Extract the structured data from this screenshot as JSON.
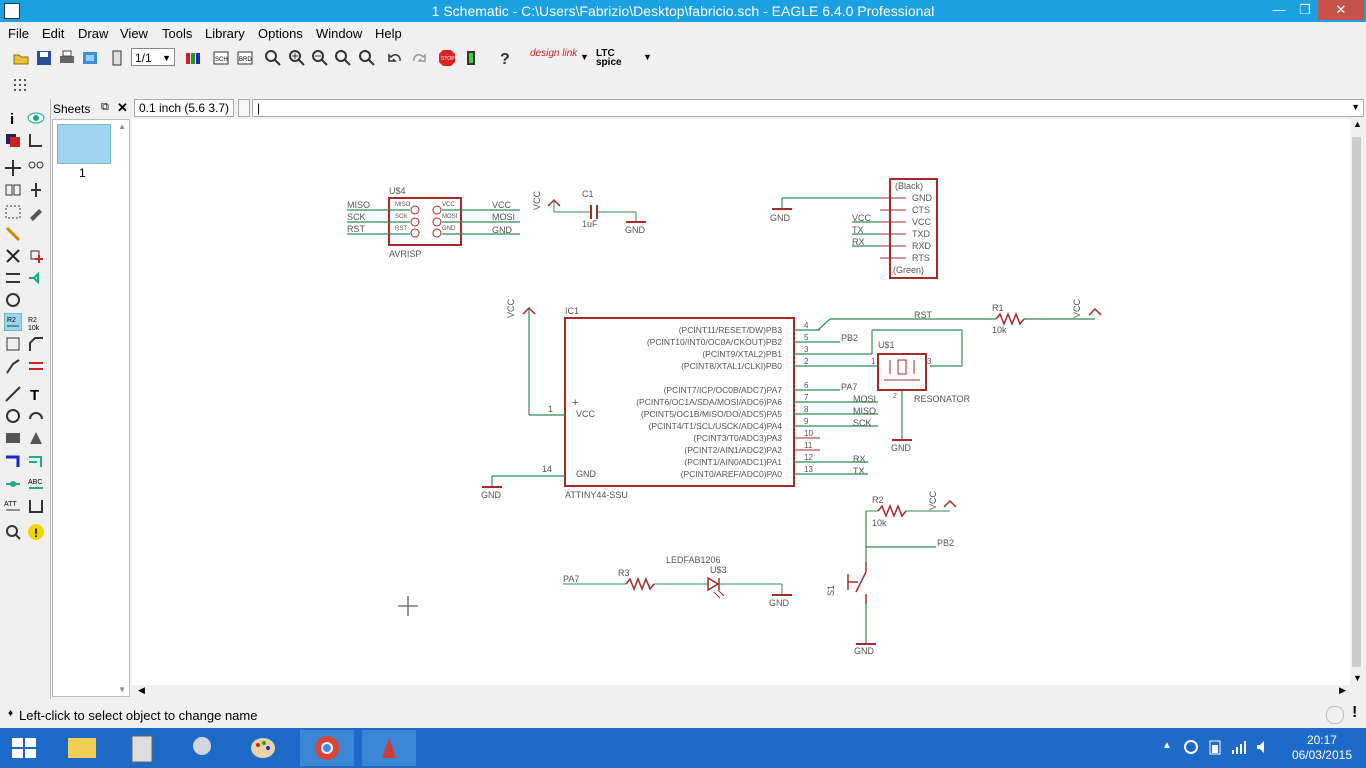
{
  "window": {
    "title": "1 Schematic - C:\\Users\\Fabrizio\\Desktop\\fabricio.sch - EAGLE 6.4.0 Professional"
  },
  "menu": [
    "File",
    "Edit",
    "Draw",
    "View",
    "Tools",
    "Library",
    "Options",
    "Window",
    "Help"
  ],
  "toolbar": {
    "zoom_value": "1/1",
    "designlink": "design link",
    "ltc": "LTC spice"
  },
  "sheets": {
    "title": "Sheets",
    "items": [
      "1"
    ]
  },
  "coords": "0.1 inch (5.6 3.7)",
  "schematic": {
    "u4": {
      "name": "U$4",
      "value": "AVRISP",
      "left_nets": [
        "MISO",
        "SCK",
        "RST"
      ],
      "right_nets": [
        "VCC",
        "MOSI",
        "GND"
      ],
      "pins_left": [
        "MISO",
        "SCK",
        "RST"
      ],
      "pins_right": [
        "VCC",
        "MOSI",
        "GND"
      ]
    },
    "c1": {
      "name": "C1",
      "value": "1uF",
      "vcc": "VCC",
      "gnd": "GND"
    },
    "ftdi": {
      "top": "(Black)",
      "bottom": "(Green)",
      "pins": [
        "GND",
        "CTS",
        "VCC",
        "TXD",
        "RXD",
        "RTS"
      ],
      "nets": [
        "VCC",
        "TX",
        "RX"
      ],
      "gnd": "GND"
    },
    "ic1": {
      "name": "IC1",
      "value": "ATTINY44-SSU",
      "vcc_pin": "VCC",
      "gnd_pin": "GND",
      "vcc": "VCC",
      "gnd": "GND",
      "pins": [
        {
          "num": "4",
          "label": "(PCINT11/RESET/DW)PB3"
        },
        {
          "num": "5",
          "label": "(PCINT10/INT0/OC0A/CKOUT)PB2"
        },
        {
          "num": "3",
          "label": "(PCINT9/XTAL2)PB1"
        },
        {
          "num": "2",
          "label": "(PCINT8/XTAL1/CLKI)PB0"
        },
        {
          "num": "6",
          "label": "(PCINT7/ICP/OC0B/ADC7)PA7"
        },
        {
          "num": "7",
          "label": "(PCINT6/OC1A/SDA/MOSI/ADC6)PA6"
        },
        {
          "num": "8",
          "label": "(PCINT5/OC1B/MISO/DO/ADC5)PA5"
        },
        {
          "num": "9",
          "label": "(PCINT4/T1/SCL/USCK/ADC4)PA4"
        },
        {
          "num": "10",
          "label": "(PCINT3/T0/ADC3)PA3"
        },
        {
          "num": "11",
          "label": "(PCINT2/AIN1/ADC2)PA2"
        },
        {
          "num": "12",
          "label": "(PCINT1/AIN0/ADC1)PA1"
        },
        {
          "num": "13",
          "label": "(PCINT0/AREF/ADC0)PA0"
        }
      ],
      "pin1": "1",
      "pin14": "14",
      "nets": {
        "pb2": "PB2",
        "pa7": "PA7",
        "mosi": "MOSI",
        "miso": "MISO",
        "sck": "SCK",
        "rx": "RX",
        "tx": "TX",
        "rst": "RST"
      }
    },
    "r1": {
      "name": "R1",
      "value": "10k",
      "vcc": "VCC"
    },
    "u1": {
      "name": "U$1",
      "value": "RESONATOR",
      "p1": "1",
      "p2": "2",
      "p3": "3",
      "gnd": "GND"
    },
    "r2": {
      "name": "R2",
      "value": "10k",
      "vcc": "VCC",
      "net": "PB2",
      "gnd": "GND",
      "s1": "S1"
    },
    "led": {
      "name": "U$3",
      "value": "LEDFAB1206",
      "r3": "R3",
      "net": "PA7",
      "gnd": "GND"
    }
  },
  "status": "Left-click to select object to change name",
  "clock": {
    "time": "20:17",
    "date": "06/03/2015"
  }
}
